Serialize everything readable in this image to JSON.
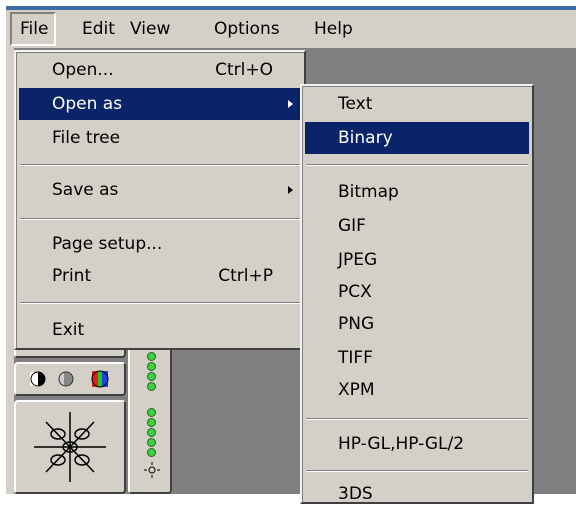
{
  "menubar": {
    "items": [
      {
        "label": "File"
      },
      {
        "label": "Edit"
      },
      {
        "label": "View"
      },
      {
        "label": "Options"
      },
      {
        "label": "Help"
      }
    ]
  },
  "file_menu": {
    "open": {
      "label": "Open...",
      "shortcut": "Ctrl+O"
    },
    "open_as": {
      "label": "Open as"
    },
    "file_tree": {
      "label": "File tree"
    },
    "save_as": {
      "label": "Save as"
    },
    "page_setup": {
      "label": "Page setup..."
    },
    "print": {
      "label": "Print",
      "shortcut": "Ctrl+P"
    },
    "exit": {
      "label": "Exit"
    }
  },
  "open_as_menu": {
    "items": [
      {
        "label": "Text"
      },
      {
        "label": "Binary"
      },
      {
        "label": "Bitmap"
      },
      {
        "label": "GIF"
      },
      {
        "label": "JPEG"
      },
      {
        "label": "PCX"
      },
      {
        "label": "PNG"
      },
      {
        "label": "TIFF"
      },
      {
        "label": "XPM"
      },
      {
        "label": "HP-GL,HP-GL/2"
      },
      {
        "label": "3DS"
      }
    ],
    "highlighted": "Binary"
  },
  "colors": {
    "highlight": "#0a246a",
    "face": "#d4d0c8",
    "workspace": "#808080",
    "led": "#3fd13f"
  }
}
